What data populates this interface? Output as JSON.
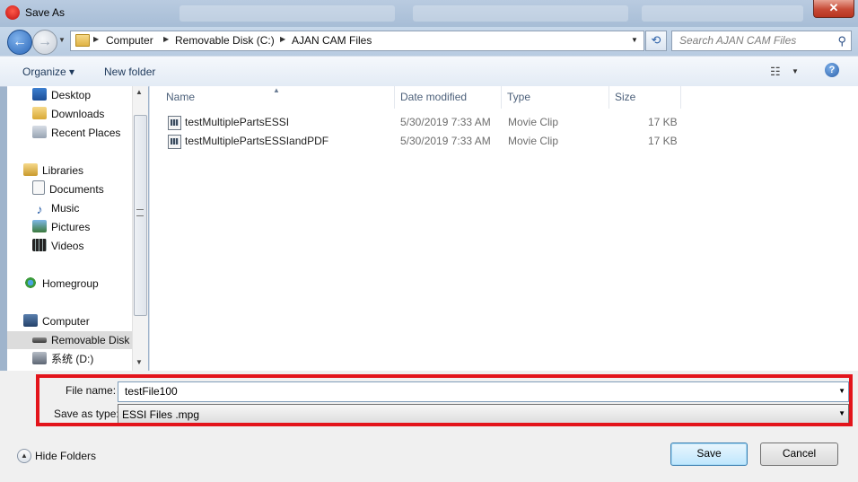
{
  "window": {
    "title": "Save As",
    "close_label": "✕"
  },
  "nav_buttons": {
    "back": "←",
    "forward": "→"
  },
  "breadcrumb": [
    "Computer",
    "Removable Disk (C:)",
    "AJAN CAM Files"
  ],
  "search": {
    "placeholder": "Search AJAN CAM Files"
  },
  "toolbar": {
    "organize": "Organize ▾",
    "new_folder": "New folder",
    "help": "?"
  },
  "sidebar": {
    "items": [
      {
        "label": "Desktop"
      },
      {
        "label": "Downloads"
      },
      {
        "label": "Recent Places"
      },
      {
        "label": "Libraries"
      },
      {
        "label": "Documents"
      },
      {
        "label": "Music"
      },
      {
        "label": "Pictures"
      },
      {
        "label": "Videos"
      },
      {
        "label": "Homegroup"
      },
      {
        "label": "Computer"
      },
      {
        "label": "Removable Disk ("
      },
      {
        "label": "系统 (D:)"
      }
    ]
  },
  "file_list": {
    "columns": [
      "Name",
      "Date modified",
      "Type",
      "Size"
    ],
    "rows": [
      {
        "name": "testMultiplePartsESSI",
        "date": "5/30/2019 7:33 AM",
        "type": "Movie Clip",
        "size": "17 KB"
      },
      {
        "name": "testMultiplePartsESSIandPDF",
        "date": "5/30/2019 7:33 AM",
        "type": "Movie Clip",
        "size": "17 KB"
      }
    ]
  },
  "form": {
    "file_name_label": "File name:",
    "file_name_value": "testFile100",
    "save_type_label": "Save as type:",
    "save_type_value": "ESSI Files .mpg"
  },
  "footer": {
    "hide_folders": "Hide Folders",
    "save": "Save",
    "cancel": "Cancel"
  },
  "colors": {
    "highlight_border": "#e3141b",
    "selected_nav": "#dcdcdc"
  }
}
